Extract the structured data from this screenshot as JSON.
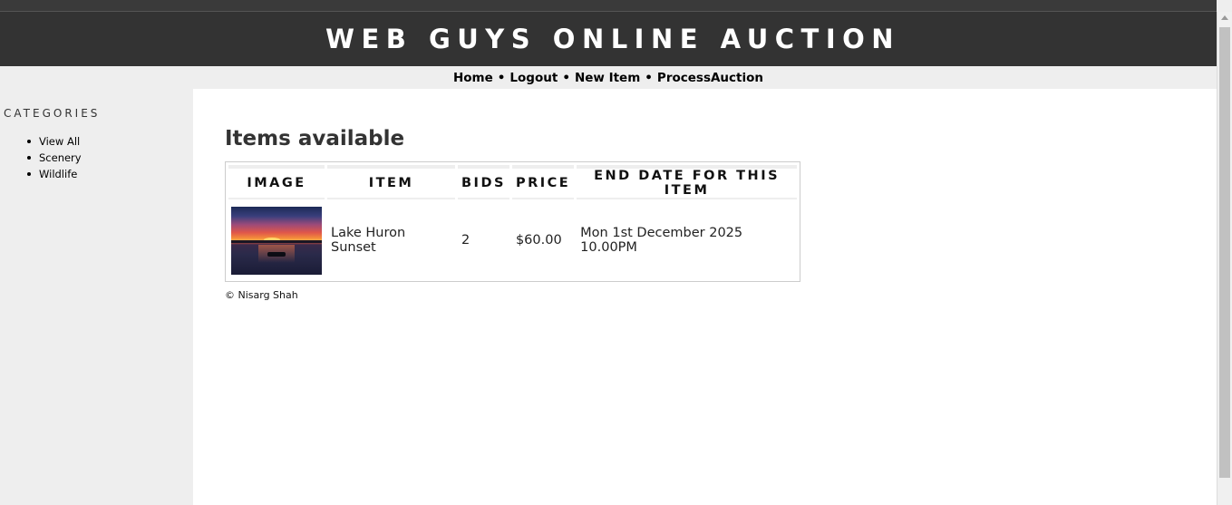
{
  "header": {
    "title": "WEB GUYS ONLINE AUCTION"
  },
  "nav": {
    "items": [
      "Home",
      "Logout",
      "New Item",
      "ProcessAuction"
    ],
    "separator": "•"
  },
  "sidebar": {
    "heading": "CATEGORIES",
    "items": [
      "View All",
      "Scenery",
      "Wildlife"
    ]
  },
  "main": {
    "heading": "Items available",
    "table": {
      "headers": [
        "IMAGE",
        "ITEM",
        "BIDS",
        "PRICE",
        "END DATE FOR THIS ITEM"
      ],
      "rows": [
        {
          "image_icon": "sunset-thumbnail",
          "item": "Lake Huron Sunset",
          "bids": "2",
          "price": "$60.00",
          "end_date": "Mon 1st December 2025 10.00PM"
        }
      ]
    },
    "footer": "© Nisarg Shah"
  },
  "colors": {
    "header_bg": "#333333",
    "page_bg": "#eeeeee",
    "content_bg": "#ffffff"
  }
}
